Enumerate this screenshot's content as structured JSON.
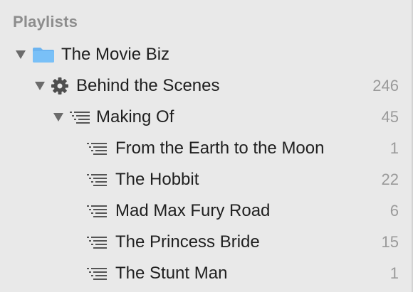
{
  "sidebar": {
    "header": "Playlists",
    "items": [
      {
        "label": "The Movie Biz",
        "count": ""
      },
      {
        "label": "Behind the Scenes",
        "count": "246"
      },
      {
        "label": "Making Of",
        "count": "45"
      },
      {
        "label": "From the Earth to the Moon",
        "count": "1"
      },
      {
        "label": "The Hobbit",
        "count": "22"
      },
      {
        "label": "Mad Max Fury Road",
        "count": "6"
      },
      {
        "label": "The Princess Bride",
        "count": "15"
      },
      {
        "label": "The Stunt Man",
        "count": "1"
      }
    ]
  },
  "icons": {
    "folder": "folder-icon",
    "smart_playlist": "gear-icon",
    "playlist": "playlist-icon",
    "expanded": "disclosure-triangle-icon"
  },
  "colors": {
    "background": "#e9e9e9",
    "folder_blue": "#6cb4f0",
    "text": "#1f1f1f",
    "muted_text": "#8d8d8d",
    "count_text": "#9a9a9a"
  }
}
